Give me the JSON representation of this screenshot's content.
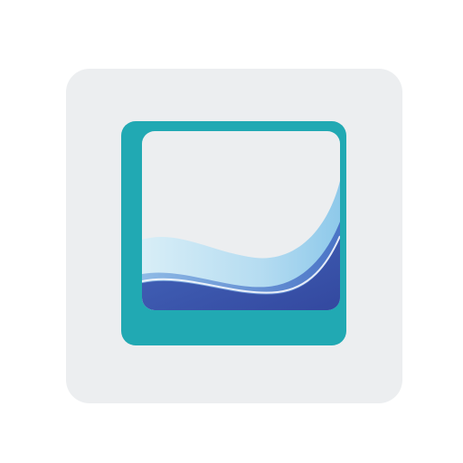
{
  "icon": {
    "name": "wave-picture-frame-icon",
    "colors": {
      "tile_background": "#eceef0",
      "frame": "#21a9b3",
      "screen": "#eceef0",
      "wave_light": "#a8d6ee",
      "wave_mid": "#6aa6e0",
      "wave_dark": "#3b56b0"
    }
  }
}
